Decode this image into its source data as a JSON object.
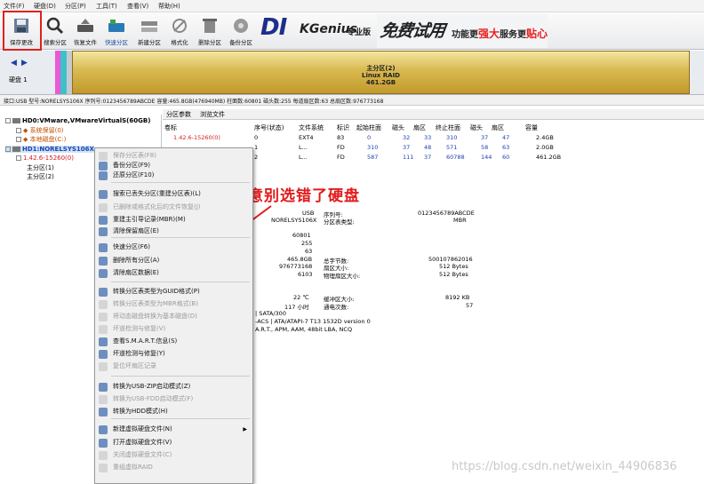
{
  "menu": [
    "文件(F)",
    "硬盘(D)",
    "分区(P)",
    "工具(T)",
    "查看(V)",
    "帮助(H)"
  ],
  "toolbar": [
    {
      "label": "保存更改",
      "icon": "save-icon"
    },
    {
      "label": "搜索分区",
      "icon": "search-icon"
    },
    {
      "label": "恢复文件",
      "icon": "recover-icon"
    },
    {
      "label": "快速分区",
      "icon": "quick-partition-icon"
    },
    {
      "label": "新建分区",
      "icon": "new-partition-icon"
    },
    {
      "label": "格式化",
      "icon": "format-icon"
    },
    {
      "label": "删除分区",
      "icon": "delete-icon"
    },
    {
      "label": "备份分区",
      "icon": "backup-icon"
    }
  ],
  "logo": {
    "brand_d": "DI",
    "brand_g": "KGenius",
    "edition": "专业版"
  },
  "ad": {
    "big": "免费试用",
    "part1": "功能更",
    "red": "强大",
    "part2": "服务更",
    "red2": "贴心"
  },
  "disk_bar": {
    "disk_label": "硬盘 1",
    "partition_type": "主分区(2)",
    "fs": "Linux RAID",
    "size": "461.2GB"
  },
  "info_line": "接口:USB  型号:NORELSYS106X  序列号:0123456789ABCDE  容量:465.8GB(476940MB)  柱面数:60801  磁头数:255  每道扇区数:63  总扇区数:976773168",
  "tree": {
    "hd0": "HD0:VMware,VMwareVirtualS(60GB)",
    "hd0_p1": "系统保留(0)",
    "hd0_p2": "本地磁盘(C:)",
    "hd1": "HD1:NORELSYS106X",
    "hd1_p0": "1.42.6-15260(0)",
    "hd1_p1": "主分区(1)",
    "hd1_p2": "主分区(2)"
  },
  "tabs": [
    "分区参数",
    "浏览文件"
  ],
  "table": {
    "headers": [
      "卷标",
      "序号(状态)",
      "文件系统",
      "标识",
      "起始柱面",
      "磁头",
      "扇区",
      "终止柱面",
      "磁头",
      "扇区",
      "容量"
    ],
    "rows": [
      [
        "1.42.6-15260(0)",
        "0",
        "EXT4",
        "83",
        "0",
        "32",
        "33",
        "310",
        "37",
        "47",
        "2.4GB"
      ],
      [
        "",
        "1",
        "L...",
        "FD",
        "310",
        "37",
        "48",
        "571",
        "58",
        "63",
        "2.0GB"
      ],
      [
        "",
        "2",
        "L...",
        "FD",
        "587",
        "111",
        "37",
        "60788",
        "144",
        "60",
        "461.2GB"
      ]
    ]
  },
  "details": {
    "iface_val": "USB",
    "model_val": "NORELSYS106X",
    "sn_label": "序列号:",
    "sn_val": "0123456789ABCDE",
    "pt_label": "分区表类型:",
    "pt_val": "MBR",
    "cyl": "60801",
    "heads": "255",
    "spt": "63",
    "cap": "465.8GB",
    "total_label": "总字节数:",
    "total_val": "500107862016",
    "sectors": "976773168",
    "sector_label": "扇区大小:",
    "sector_val": "512 Bytes",
    "phys": "6103",
    "phys_label": "物理扇区大小:",
    "phys_val": "512 Bytes",
    "temp": "22 ℃",
    "temp_label": "缓冲区大小:",
    "temp_val": "8192 KB",
    "hours": "117 小时",
    "hours_label": "通电次数:",
    "hours_val": "57",
    "sata": "| SATA/300",
    "ata": "-ACS | ATA/ATAPI-7 T13 1532D version 0",
    "feat": "A.R.T., APM, AAM, 48bit LBA, NCQ"
  },
  "context_menu": [
    {
      "label": "保存分区表(F8)",
      "disabled": true
    },
    {
      "label": "备份分区(F9)",
      "disabled": false
    },
    {
      "label": "还原分区(F10)",
      "disabled": false
    },
    {
      "label": "搜索已丢失分区(重建分区表)(L)",
      "disabled": false
    },
    {
      "label": "已删除或格式化后的文件恢复(J)",
      "disabled": true
    },
    {
      "label": "重建主引导记录(MBR)(M)",
      "disabled": false
    },
    {
      "label": "清除保留扇区(E)",
      "disabled": false
    },
    {
      "label": "快速分区(F6)",
      "disabled": false
    },
    {
      "label": "删除所有分区(A)",
      "disabled": false
    },
    {
      "label": "清除扇区数据(E)",
      "disabled": false
    },
    {
      "label": "转换分区表类型为GUID格式(P)",
      "disabled": false
    },
    {
      "label": "转换分区表类型为MBR格式(B)",
      "disabled": true
    },
    {
      "label": "将动态磁盘转换为基本磁盘(D)",
      "disabled": true
    },
    {
      "label": "坏道检测与修复(V)",
      "disabled": true
    },
    {
      "label": "查看S.M.A.R.T.信息(S)",
      "disabled": false
    },
    {
      "label": "坏道检测与修复(Y)",
      "disabled": false
    },
    {
      "label": "复位坏扇区记录",
      "disabled": true
    },
    {
      "label": "转换为USB-ZIP启动模式(Z)",
      "disabled": false
    },
    {
      "label": "转换为USB-FDD启动模式(F)",
      "disabled": true
    },
    {
      "label": "转换为HDD模式(H)",
      "disabled": false
    },
    {
      "label": "新建虚拟硬盘文件(N)",
      "disabled": false
    },
    {
      "label": "打开虚拟硬盘文件(V)",
      "disabled": false
    },
    {
      "label": "关闭虚拟硬盘文件(C)",
      "disabled": true
    },
    {
      "label": "重组虚拟RAID",
      "disabled": true
    }
  ],
  "annotation": "注意别选错了硬盘",
  "watermark": "https://blog.csdn.net/weixin_44906836",
  "colors": {
    "highlight_red": "#e02020",
    "partition_gold": "#d8b950",
    "selection_blue": "#cde3f7"
  }
}
